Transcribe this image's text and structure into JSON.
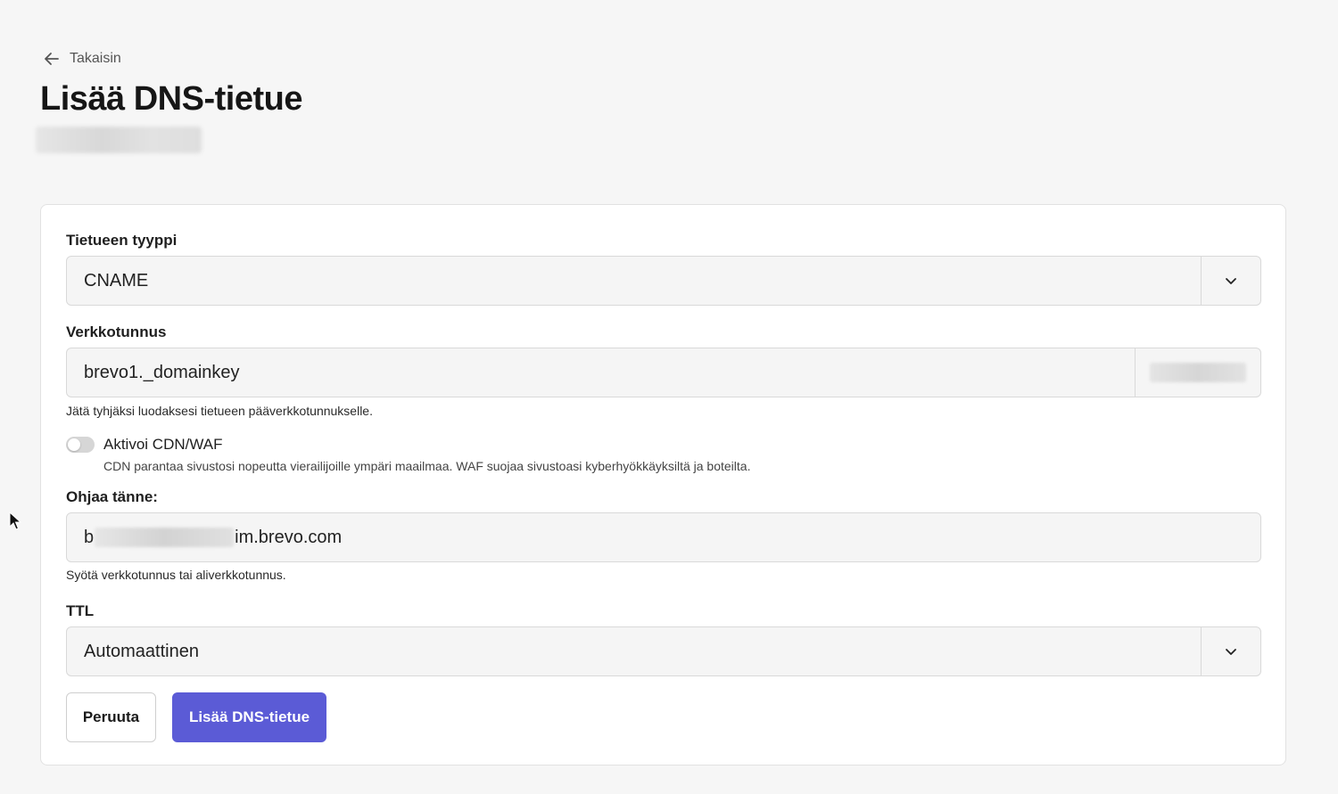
{
  "header": {
    "back_label": "Takaisin",
    "title": "Lisää DNS-tietue"
  },
  "form": {
    "record_type": {
      "label": "Tietueen tyyppi",
      "value": "CNAME"
    },
    "domain": {
      "label": "Verkkotunnus",
      "value": "brevo1._domainkey",
      "help": "Jätä tyhjäksi luodaksesi tietueen pääverkkotunnukselle."
    },
    "cdn": {
      "label": "Aktivoi CDN/WAF",
      "enabled": false,
      "help": "CDN parantaa sivustosi nopeutta vierailijoille ympäri maailmaa. WAF suojaa sivustoasi kyberhyökkäyksiltä ja boteilta."
    },
    "redirect": {
      "label": "Ohjaa tänne:",
      "value_start": "b",
      "value_end": "im.brevo.com",
      "help": "Syötä verkkotunnus tai aliverkkotunnus."
    },
    "ttl": {
      "label": "TTL",
      "value": "Automaattinen"
    }
  },
  "actions": {
    "cancel_label": "Peruuta",
    "submit_label": "Lisää DNS-tietue"
  },
  "colors": {
    "primary": "#5b5bd6",
    "background": "#f6f6f6",
    "card": "#ffffff",
    "field_bg": "#f5f5f5"
  },
  "icons": {
    "back": "arrow-left-icon",
    "select": "chevron-down-icon",
    "cursor": "mouse-pointer-icon"
  }
}
